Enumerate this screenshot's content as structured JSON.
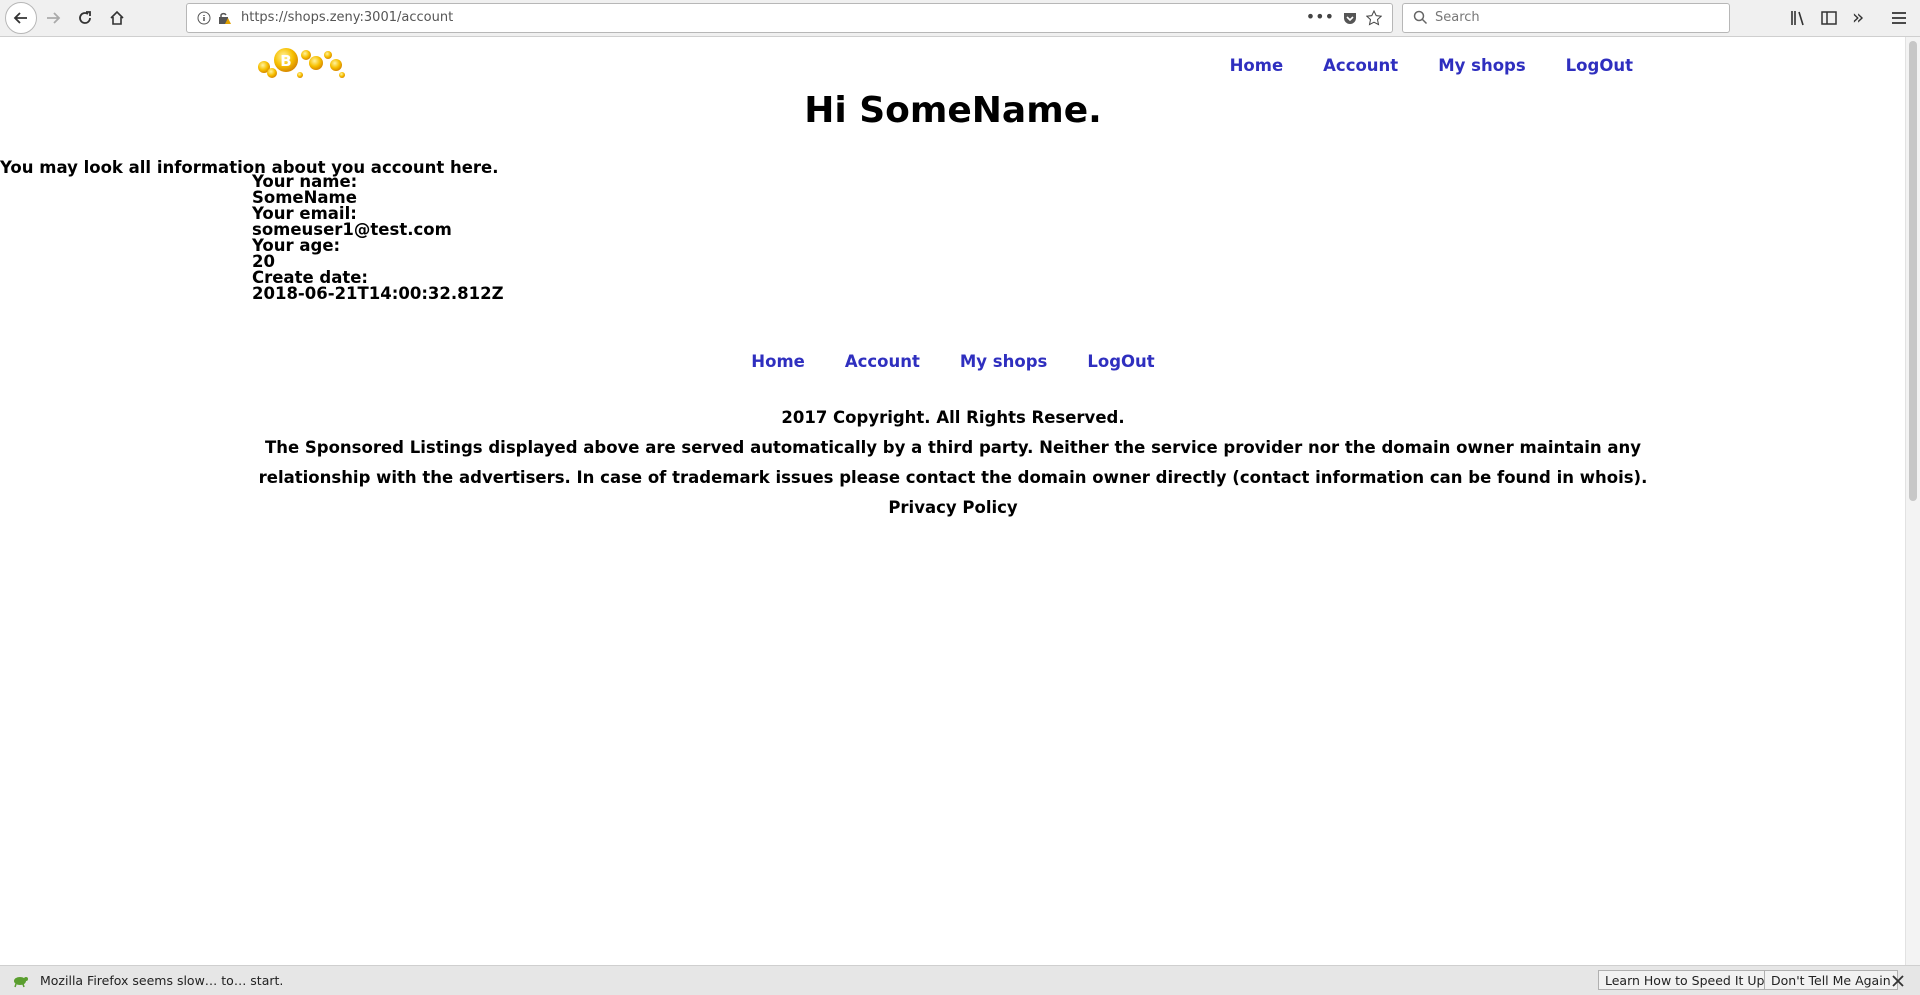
{
  "browser": {
    "url": "https://shops.zeny:3001/account",
    "search_placeholder": "Search"
  },
  "nav": {
    "items": [
      "Home",
      "Account",
      "My shops",
      "LogOut"
    ]
  },
  "page": {
    "greeting": "Hi SomeName.",
    "intro": "You may look all information about you account here.",
    "fields": [
      {
        "label": "Your name:",
        "value": "SomeName"
      },
      {
        "label": "Your email:",
        "value": "someuser1@test.com"
      },
      {
        "label": "Your age:",
        "value": "20"
      },
      {
        "label": "Create date:",
        "value": "2018-06-21T14:00:32.812Z"
      }
    ]
  },
  "footer": {
    "copyright": "2017 Copyright. All Rights Reserved.",
    "disclaimer": "The Sponsored Listings displayed above are served automatically by a third party. Neither the service provider nor the domain owner maintain any relationship with the advertisers. In case of trademark issues please contact the domain owner directly (contact information can be found in whois).",
    "privacy": "Privacy Policy"
  },
  "notification": {
    "text": "Mozilla Firefox seems slow… to… start.",
    "learn_button": "Learn How to Speed It Up",
    "dismiss_button": "Don't Tell Me Again"
  }
}
